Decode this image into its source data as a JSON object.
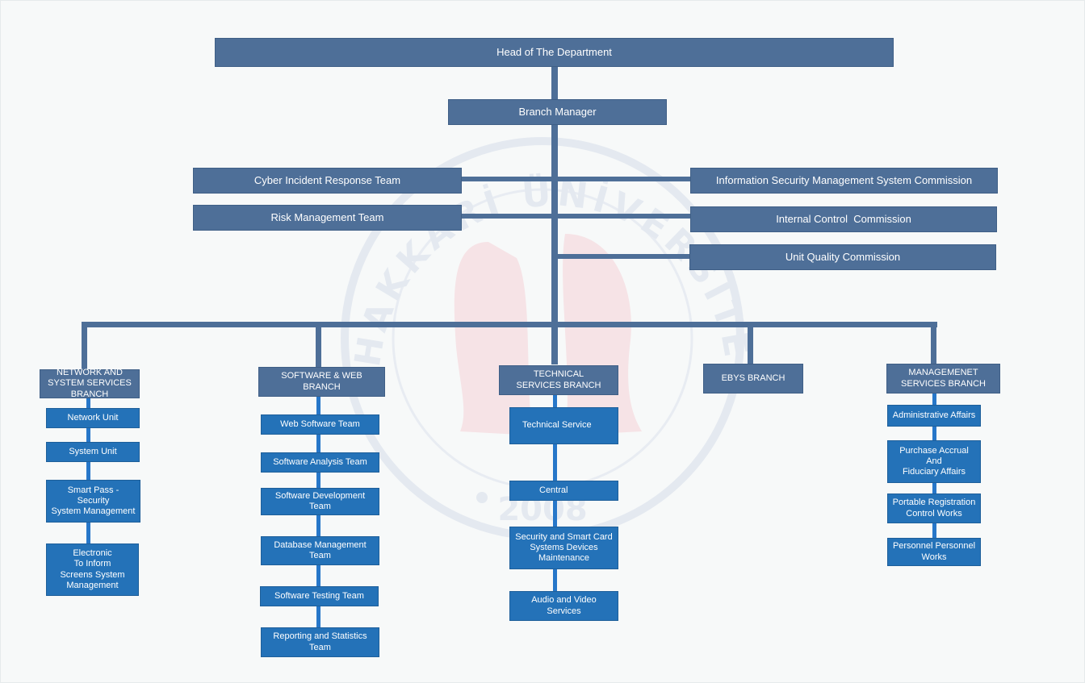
{
  "colors": {
    "background": "#f7f9f9",
    "primary_box": "#4e6f98",
    "unit_box": "#2472b8",
    "unit_connector": "#2777c9",
    "watermark": "#e4e9f0",
    "watermark_accent": "#f6e3e6"
  },
  "watermark": {
    "text": "HAKKARİ ÜNİVERSİTESİ",
    "year": "2008"
  },
  "top": {
    "head": "Head of The Department",
    "manager": "Branch Manager"
  },
  "staff": {
    "left": [
      "Cyber Incident Response Team",
      "Risk Management Team"
    ],
    "right": [
      "Information Security Management System Commission",
      "Internal Control  Commission",
      "Unit Quality Commission"
    ]
  },
  "branches": [
    {
      "name": "NETWORK AND SYSTEM SERVICES BRANCH",
      "units": [
        "Network Unit",
        "System Unit",
        "Smart Pass -\nSecurity\nSystem Management",
        "Electronic\nTo Inform\nScreens System\nManagement"
      ]
    },
    {
      "name": "SOFTWARE & WEB BRANCH",
      "units": [
        "Web Software Team",
        "Software Analysis Team",
        "Software Development\nTeam",
        "Database Management\nTeam",
        "Software Testing Team",
        "Reporting and Statistics\nTeam"
      ]
    },
    {
      "name": "TECHNICAL SERVICES BRANCH",
      "units": [
        "Technical Service",
        "Central",
        "Security and Smart Card\nSystems Devices\nMaintenance",
        "Audio and Video\nServices"
      ]
    },
    {
      "name": "EBYS BRANCH",
      "units": []
    },
    {
      "name": "MANAGEMENET SERVICES BRANCH",
      "units": [
        "Administrative Affairs",
        "Purchase Accrual\nAnd\nFiduciary Affairs",
        "Portable Registration\nControl Works",
        "Personnel Personnel\nWorks"
      ]
    }
  ]
}
